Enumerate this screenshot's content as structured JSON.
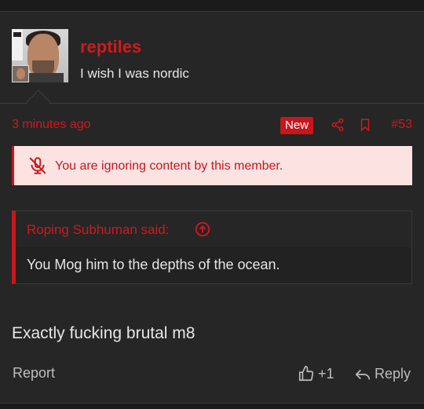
{
  "post": {
    "username": "reptiles",
    "user_title": "I wish I was nordic",
    "avatar_icon": "avatar-image",
    "time": "3 minutes ago",
    "new_badge": "New",
    "post_number": "#53",
    "ignored_notice": "You are ignoring content by this member.",
    "quote": {
      "author": "Roping Subhuman said:",
      "body": "You Mog him to the depths of the ocean."
    },
    "message": "Exactly fucking brutal m8",
    "actions": {
      "report": "Report",
      "like_count": "+1",
      "reply": "Reply"
    }
  },
  "colors": {
    "accent": "#d0191d",
    "background": "#262626",
    "notice_bg": "#fde2e2"
  }
}
